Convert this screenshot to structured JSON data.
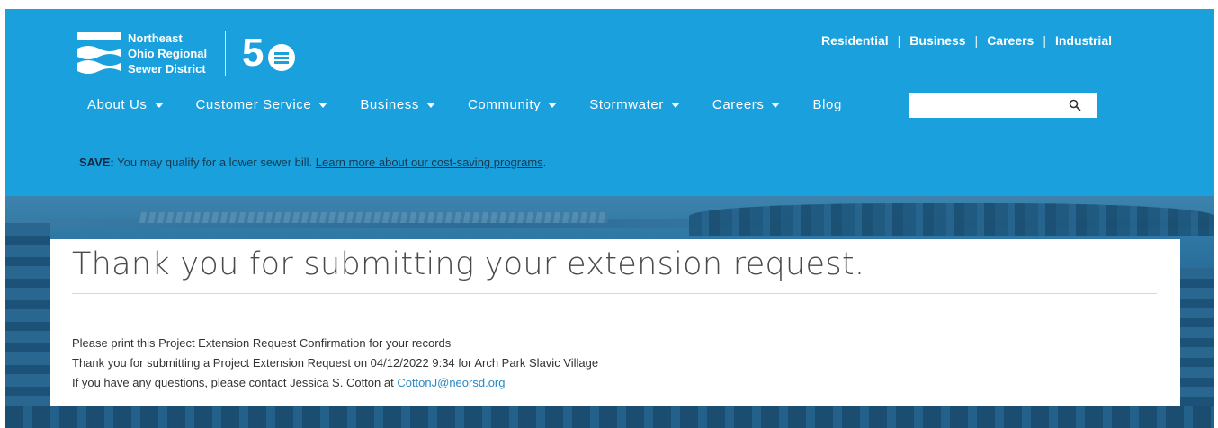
{
  "logo": {
    "line1": "Northeast",
    "line2": "Ohio Regional",
    "line3": "Sewer District",
    "anniversary": "50"
  },
  "utility_links": [
    "Residential",
    "Business",
    "Careers",
    "Industrial"
  ],
  "nav": {
    "items": [
      "About Us",
      "Customer Service",
      "Business",
      "Community",
      "Stormwater",
      "Careers"
    ],
    "blog": "Blog"
  },
  "search": {
    "placeholder": "",
    "icon": "search-icon"
  },
  "save_banner": {
    "label": "SAVE:",
    "text": " You may qualify for a lower sewer bill. ",
    "link": "Learn more about our cost-saving programs",
    "suffix": "."
  },
  "confirmation": {
    "title": "Thank you for submitting your extension request.",
    "line1": "Please print this Project Extension Request Confirmation for your records",
    "line2": "Thank you for submitting a Project Extension Request on 04/12/2022 9:34 for Arch Park Slavic Village",
    "line3_prefix": "If you have any questions, please contact Jessica S. Cotton at ",
    "email": "CottonJ@neorsd.org"
  },
  "colors": {
    "header_blue": "#1aa0dd",
    "link_blue": "#2a88c5"
  }
}
